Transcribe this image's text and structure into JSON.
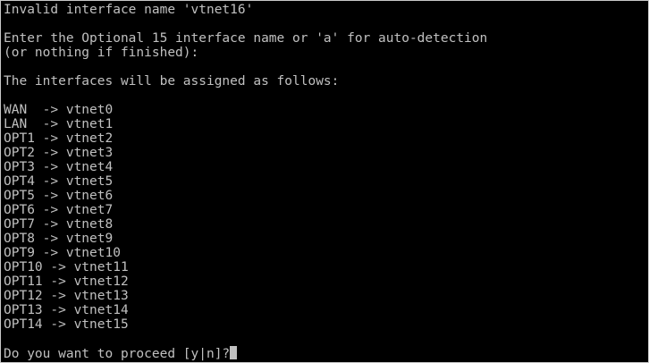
{
  "console": {
    "error_line": "Invalid interface name 'vtnet16'",
    "prompt_line1": "Enter the Optional 15 interface name or 'a' for auto-detection",
    "prompt_line2": "(or nothing if finished):",
    "assign_heading": "The interfaces will be assigned as follows:",
    "assignments": [
      "WAN  -> vtnet0",
      "LAN  -> vtnet1",
      "OPT1 -> vtnet2",
      "OPT2 -> vtnet3",
      "OPT3 -> vtnet4",
      "OPT4 -> vtnet5",
      "OPT5 -> vtnet6",
      "OPT6 -> vtnet7",
      "OPT7 -> vtnet8",
      "OPT8 -> vtnet9",
      "OPT9 -> vtnet10",
      "OPT10 -> vtnet11",
      "OPT11 -> vtnet12",
      "OPT12 -> vtnet13",
      "OPT13 -> vtnet14",
      "OPT14 -> vtnet15"
    ],
    "proceed_prompt": "Do you want to proceed [y|n]?"
  },
  "colors": {
    "background": "#000000",
    "text": "#c0c0c0",
    "cursor": "#c0c0c0"
  }
}
